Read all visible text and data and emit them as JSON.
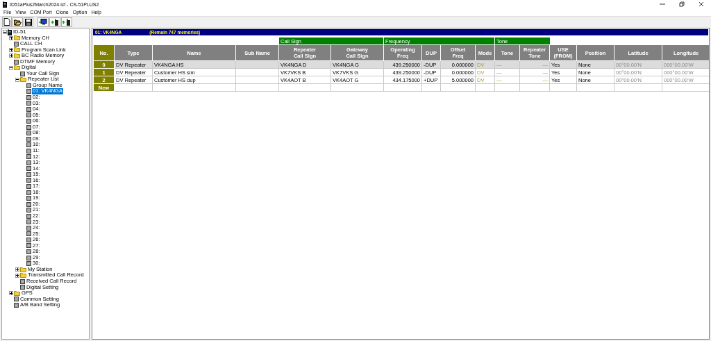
{
  "window": {
    "title": "ID51aPlus2March2024.icf - CS-51PLUS2"
  },
  "menu": [
    "File",
    "View",
    "COM Port",
    "Clone",
    "Option",
    "Help"
  ],
  "tree": [
    {
      "label": "ID-51",
      "kind": "device",
      "expanded": true,
      "selected": false,
      "children": [
        {
          "label": "Memory CH",
          "kind": "folder",
          "expanded": false,
          "selected": false
        },
        {
          "label": "CALL CH",
          "kind": "item",
          "selected": false
        },
        {
          "label": "Program Scan Link",
          "kind": "folder",
          "expanded": false,
          "selected": false
        },
        {
          "label": "BC Radio Memory",
          "kind": "folder",
          "expanded": false,
          "selected": false
        },
        {
          "label": "DTMF Memory",
          "kind": "item",
          "selected": false
        },
        {
          "label": "Digital",
          "kind": "folder",
          "expanded": true,
          "selected": false,
          "children": [
            {
              "label": "Your Call Sign",
              "kind": "item",
              "selected": false
            },
            {
              "label": "Repeater List",
              "kind": "folder",
              "expanded": true,
              "selected": false,
              "children": [
                {
                  "label": "Group Name",
                  "kind": "item",
                  "selected": false
                },
                {
                  "label": "01: VK4NGA",
                  "kind": "item",
                  "selected": true
                },
                {
                  "label": "02:",
                  "kind": "item",
                  "selected": false
                },
                {
                  "label": "03:",
                  "kind": "item",
                  "selected": false
                },
                {
                  "label": "04:",
                  "kind": "item",
                  "selected": false
                },
                {
                  "label": "05:",
                  "kind": "item",
                  "selected": false
                },
                {
                  "label": "06:",
                  "kind": "item",
                  "selected": false
                },
                {
                  "label": "07:",
                  "kind": "item",
                  "selected": false
                },
                {
                  "label": "08:",
                  "kind": "item",
                  "selected": false
                },
                {
                  "label": "09:",
                  "kind": "item",
                  "selected": false
                },
                {
                  "label": "10:",
                  "kind": "item",
                  "selected": false
                },
                {
                  "label": "11:",
                  "kind": "item",
                  "selected": false
                },
                {
                  "label": "12:",
                  "kind": "item",
                  "selected": false
                },
                {
                  "label": "13:",
                  "kind": "item",
                  "selected": false
                },
                {
                  "label": "14:",
                  "kind": "item",
                  "selected": false
                },
                {
                  "label": "15:",
                  "kind": "item",
                  "selected": false
                },
                {
                  "label": "16:",
                  "kind": "item",
                  "selected": false
                },
                {
                  "label": "17:",
                  "kind": "item",
                  "selected": false
                },
                {
                  "label": "18:",
                  "kind": "item",
                  "selected": false
                },
                {
                  "label": "19:",
                  "kind": "item",
                  "selected": false
                },
                {
                  "label": "20:",
                  "kind": "item",
                  "selected": false
                },
                {
                  "label": "21:",
                  "kind": "item",
                  "selected": false
                },
                {
                  "label": "22:",
                  "kind": "item",
                  "selected": false
                },
                {
                  "label": "23:",
                  "kind": "item",
                  "selected": false
                },
                {
                  "label": "24:",
                  "kind": "item",
                  "selected": false
                },
                {
                  "label": "25:",
                  "kind": "item",
                  "selected": false
                },
                {
                  "label": "26:",
                  "kind": "item",
                  "selected": false
                },
                {
                  "label": "27:",
                  "kind": "item",
                  "selected": false
                },
                {
                  "label": "28:",
                  "kind": "item",
                  "selected": false
                },
                {
                  "label": "29:",
                  "kind": "item",
                  "selected": false
                },
                {
                  "label": "30:",
                  "kind": "item",
                  "selected": false
                }
              ]
            },
            {
              "label": "My Station",
              "kind": "folder",
              "expanded": false,
              "selected": false
            },
            {
              "label": "Transmitted Call Record",
              "kind": "folder",
              "expanded": false,
              "selected": false
            },
            {
              "label": "Received Call Record",
              "kind": "item",
              "selected": false
            },
            {
              "label": "Digital Setting",
              "kind": "item",
              "selected": false
            }
          ]
        },
        {
          "label": "GPS",
          "kind": "folder",
          "expanded": false,
          "selected": false
        },
        {
          "label": "Common Setting",
          "kind": "item",
          "selected": false
        },
        {
          "label": "A/B Band Setting",
          "kind": "item",
          "selected": false
        }
      ]
    }
  ],
  "panel": {
    "title": "01: VK4NGA",
    "remaining": "(Remain 747 memories)"
  },
  "table": {
    "columns": [
      {
        "label": "No."
      },
      {
        "label": "Type"
      },
      {
        "label": "Name"
      },
      {
        "label": "Sub Name"
      },
      {
        "group": "Call Sign",
        "columns": [
          {
            "label": "Repeater\nCall Sign"
          },
          {
            "label": "Gateway\nCall Sign"
          }
        ]
      },
      {
        "group": "Frequency",
        "columns": [
          {
            "label": "Operating\nFreq"
          },
          {
            "label": "DUP"
          },
          {
            "label": "Offset\nFreq"
          },
          {
            "label": "Mode"
          }
        ]
      },
      {
        "group": "Tone",
        "columns": [
          {
            "label": "Tone"
          },
          {
            "label": "Repeater\nTone"
          }
        ]
      },
      {
        "label": "USE\n(FROM)"
      },
      {
        "label": "Position"
      },
      {
        "label": "Latitude"
      },
      {
        "label": "Longitude"
      }
    ],
    "rows": [
      {
        "no": "0",
        "type": "DV Repeater",
        "name": "VK4NGA HS",
        "repeater_call_sign": "VK4NGA D",
        "gateway_call_sign": "VK4NGA G",
        "operating_freq": "439.250000",
        "dup": "-DUP",
        "offset_freq": "0.000000",
        "mode": "DV",
        "tone": "—",
        "repeater_tone": "—",
        "use_from": "Yes",
        "position": "None",
        "latitude": "00°00.00'N",
        "longitude": "000°00.00'W",
        "selected": true
      },
      {
        "no": "1",
        "type": "DV Repeater",
        "name": "Customer HS sim",
        "repeater_call_sign": "VK7VKS B",
        "gateway_call_sign": "VK7VKS G",
        "operating_freq": "439.250000",
        "dup": "-DUP",
        "offset_freq": "0.000000",
        "mode": "DV",
        "tone": "—",
        "repeater_tone": "—",
        "use_from": "Yes",
        "position": "None",
        "latitude": "00°00.00'N",
        "longitude": "000°00.00'W",
        "selected": false
      },
      {
        "no": "2",
        "type": "DV Repeater",
        "name": "Customer HS dup",
        "repeater_call_sign": "VK4AOT B",
        "gateway_call_sign": "VK4AOT G",
        "operating_freq": "434.175000",
        "dup": "+DUP",
        "offset_freq": "5.000000",
        "mode": "DV",
        "tone": "—",
        "repeater_tone": "—",
        "use_from": "Yes",
        "position": "None",
        "latitude": "00°00.00'N",
        "longitude": "000°00.00'W",
        "selected": false
      }
    ],
    "new_row": "New"
  }
}
